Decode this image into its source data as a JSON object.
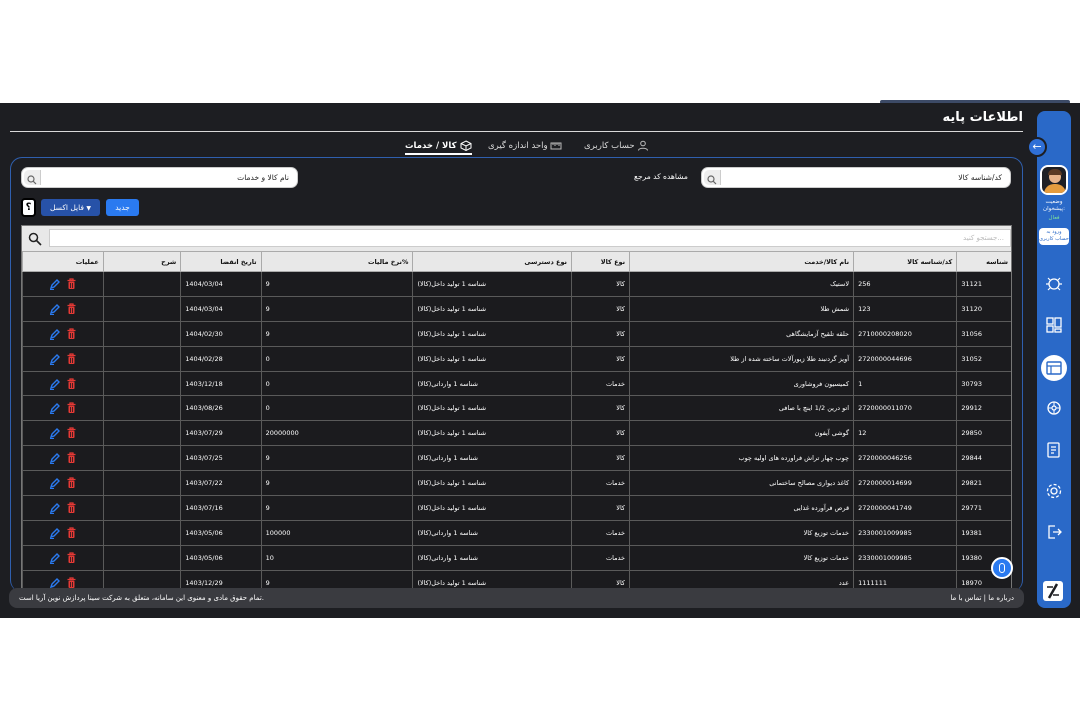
{
  "header": {
    "title": "اطلاعات پایه"
  },
  "tabs": [
    {
      "label": "حساب کاربری",
      "icon": "user-icon"
    },
    {
      "label": "واحد اندازه گیری",
      "icon": "scale-icon"
    },
    {
      "label": "کالا / خدمات",
      "icon": "box-icon",
      "active": true
    }
  ],
  "sidebar": {
    "status_label": "وضعیت پیشخوان:",
    "status_value": "فعال",
    "login_button": "ورود به حساب کاربری"
  },
  "search": {
    "code_placeholder": "کد/شناسه کالا",
    "name_placeholder": "نام کالا و خدمات",
    "ref_label": "مشاهده کد مرجع"
  },
  "toolbar": {
    "new_label": "جدید",
    "excel_label": "فایل اکسل",
    "help_label": "؟"
  },
  "table": {
    "filter_placeholder": "جستجو کنید...",
    "columns": [
      "شناسه",
      "کد/شناسه کالا",
      "نام کالا/خدمت",
      "نوع کالا",
      "نوع دسترسی",
      "%نرخ مالیات",
      "تاریخ انقضا",
      "شرح",
      "عملیات"
    ],
    "rows": [
      [
        "31121",
        "256",
        "لاستیک",
        "کالا",
        "شناسه 1 تولید داخل(کالا)",
        "9",
        "1404/03/04",
        ""
      ],
      [
        "31120",
        "123",
        "شمش طلا",
        "کالا",
        "شناسه 1 تولید داخل(کالا)",
        "9",
        "1404/03/04",
        ""
      ],
      [
        "31056",
        "2710000208020",
        "حلقه تلقیح آزمایشگاهی",
        "کالا",
        "شناسه 1 تولید داخل(کالا)",
        "9",
        "1404/02/30",
        ""
      ],
      [
        "31052",
        "2720000044696",
        "آویز گردنبند طلا زیورآلات ساخته شده از طلا",
        "کالا",
        "شناسه 1 تولید داخل(کالا)",
        "0",
        "1404/02/28",
        ""
      ],
      [
        "30793",
        "1",
        "کمیسیون فروشاوری",
        "خدمات",
        "شناسه 1 وارداتی(کالا)",
        "0",
        "1403/12/18",
        ""
      ],
      [
        "29912",
        "2720000011070",
        "اتو درین 1/2 اینچ با صافی",
        "کالا",
        "شناسه 1 تولید داخل(کالا)",
        "0",
        "1403/08/26",
        ""
      ],
      [
        "29850",
        "12",
        "گوشی آیفون",
        "کالا",
        "شناسه 1 تولید داخل(کالا)",
        "20000000",
        "1403/07/29",
        ""
      ],
      [
        "29844",
        "2720000046256",
        "چوب چهار تراش فراورده های اولیه چوب",
        "کالا",
        "شناسه 1 وارداتی(کالا)",
        "9",
        "1403/07/25",
        ""
      ],
      [
        "29821",
        "2720000014699",
        "کاغذ دیواری مصالح ساختمانی",
        "خدمات",
        "شناسه 1 تولید داخل(کالا)",
        "9",
        "1403/07/22",
        ""
      ],
      [
        "29771",
        "2720000041749",
        "قرص فرآورده غذایی",
        "کالا",
        "شناسه 1 تولید داخل(کالا)",
        "9",
        "1403/07/16",
        ""
      ],
      [
        "19381",
        "2330001009985",
        "خدمات توزیع کالا",
        "خدمات",
        "شناسه 1 وارداتی(کالا)",
        "100000",
        "1403/05/06",
        ""
      ],
      [
        "19380",
        "2330001009985",
        "خدمات توزیع کالا",
        "خدمات",
        "شناسه 1 وارداتی(کالا)",
        "10",
        "1403/05/06",
        ""
      ],
      [
        "18970",
        "1111111",
        "عدد",
        "کالا",
        "شناسه 1 تولید داخل(کالا)",
        "9",
        "1403/12/29",
        ""
      ]
    ]
  },
  "footer": {
    "copyright": "تمام حقوق مادی و معنوی این سامانه، متعلق به شرکت سینا پردازش نوین آریا است.",
    "links": "درباره ما | تماس با ما"
  },
  "colors": {
    "background": "#1d1e22",
    "accent": "#2a69c8",
    "delete": "#e53935",
    "edit": "#2a7af0"
  }
}
